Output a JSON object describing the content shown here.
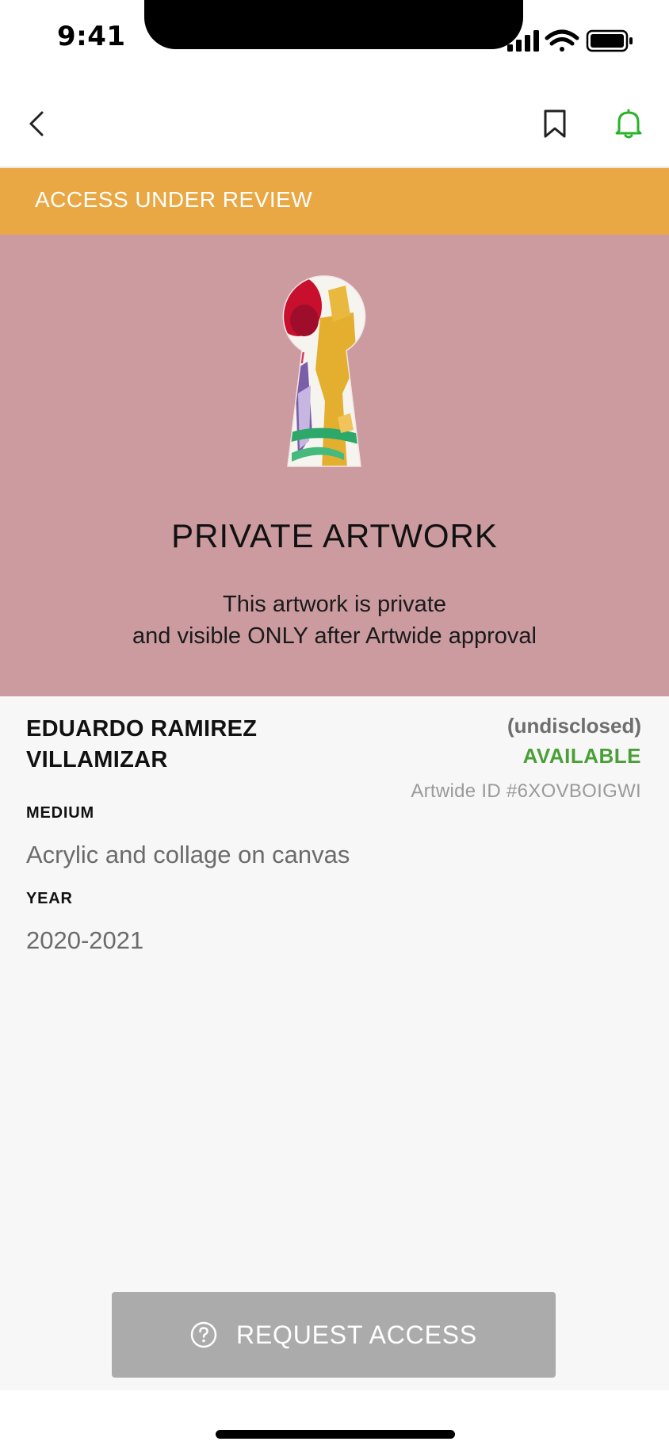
{
  "status_bar": {
    "time": "9:41",
    "icons": [
      "cellular-signal-icon",
      "wifi-icon",
      "battery-icon"
    ]
  },
  "nav": {
    "back_icon": "chevron-left-icon",
    "bookmark_icon": "bookmark-icon",
    "bell_icon": "bell-icon",
    "bell_color": "#2bb22b"
  },
  "banner": {
    "text": "ACCESS UNDER REVIEW",
    "color": "#e9a843"
  },
  "private_panel": {
    "background": "#cb9ba0",
    "icon": "keyhole-artwork-icon",
    "title": "PRIVATE ARTWORK",
    "line1": "This artwork is private",
    "line2": "and visible ONLY after Artwide approval"
  },
  "artwork": {
    "artist_line1": "EDUARDO RAMIREZ",
    "artist_line2": "VILLAMIZAR",
    "price": "(undisclosed)",
    "availability": "AVAILABLE",
    "availability_color": "#4a9f37",
    "artwide_id": "Artwide ID #6XOVBOIGWI",
    "medium_label": "MEDIUM",
    "medium_value": "Acrylic and collage on canvas",
    "year_label": "YEAR",
    "year_value": "2020-2021"
  },
  "action": {
    "icon": "question-circle-icon",
    "label": "REQUEST ACCESS"
  }
}
